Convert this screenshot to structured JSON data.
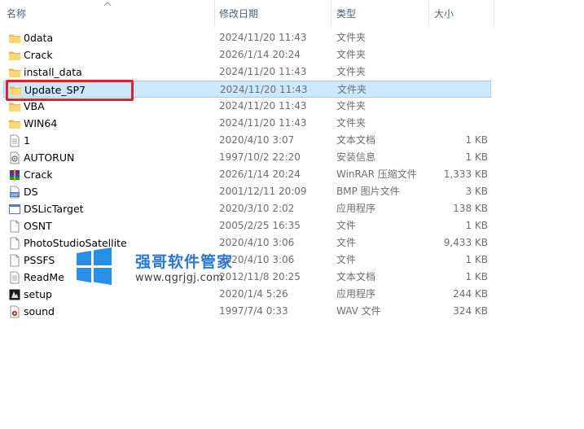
{
  "columns": {
    "name": "名称",
    "date": "修改日期",
    "type": "类型",
    "size": "大小"
  },
  "files": [
    {
      "name": "0data",
      "date": "2024/11/20 11:43",
      "type": "文件夹",
      "size": "",
      "icon": "folder-icon"
    },
    {
      "name": "Crack",
      "date": "2026/1/14 20:24",
      "type": "文件夹",
      "size": "",
      "icon": "folder-icon"
    },
    {
      "name": "install_data",
      "date": "2024/11/20 11:43",
      "type": "文件夹",
      "size": "",
      "icon": "folder-icon"
    },
    {
      "name": "Update_SP7",
      "date": "2024/11/20 11:43",
      "type": "文件夹",
      "size": "",
      "icon": "folder-icon",
      "selected": true
    },
    {
      "name": "VBA",
      "date": "2024/11/20 11:43",
      "type": "文件夹",
      "size": "",
      "icon": "folder-icon"
    },
    {
      "name": "WIN64",
      "date": "2024/11/20 11:43",
      "type": "文件夹",
      "size": "",
      "icon": "folder-icon"
    },
    {
      "name": "1",
      "date": "2020/4/10 3:07",
      "type": "文本文档",
      "size": "1 KB",
      "icon": "text-document-icon"
    },
    {
      "name": "AUTORUN",
      "date": "1997/10/2 22:20",
      "type": "安装信息",
      "size": "1 KB",
      "icon": "setup-info-icon"
    },
    {
      "name": "Crack",
      "date": "2026/1/14 20:24",
      "type": "WinRAR 压缩文件",
      "size": "1,333 KB",
      "icon": "winrar-archive-icon"
    },
    {
      "name": "DS",
      "date": "2001/12/11 20:09",
      "type": "BMP 图片文件",
      "size": "3 KB",
      "icon": "bmp-image-icon"
    },
    {
      "name": "DSLicTarget",
      "date": "2020/3/10 2:02",
      "type": "应用程序",
      "size": "138 KB",
      "icon": "application-icon"
    },
    {
      "name": "OSNT",
      "date": "2005/2/25 16:35",
      "type": "文件",
      "size": "1 KB",
      "icon": "blank-file-icon"
    },
    {
      "name": "PhotoStudioSatellite",
      "date": "2020/4/10 3:06",
      "type": "文件",
      "size": "9,433 KB",
      "icon": "blank-file-icon"
    },
    {
      "name": "PSSFS",
      "date": "2020/4/10 3:06",
      "type": "文件",
      "size": "1 KB",
      "icon": "blank-file-icon"
    },
    {
      "name": "ReadMe",
      "date": "2012/11/8 20:25",
      "type": "文本文档",
      "size": "1 KB",
      "icon": "text-document-icon"
    },
    {
      "name": "setup",
      "date": "2020/1/4 5:26",
      "type": "应用程序",
      "size": "244 KB",
      "icon": "setup-app-icon"
    },
    {
      "name": "sound",
      "date": "1997/7/4 0:33",
      "type": "WAV 文件",
      "size": "324 KB",
      "icon": "wav-audio-icon"
    }
  ],
  "watermark": {
    "title": "强哥软件管家",
    "url": "www.qgrjgj.com"
  },
  "colors": {
    "selection_bg": "#cce8ff",
    "selection_border": "#99d1ff",
    "highlight_box": "#e0202a",
    "folder": "#f8d775",
    "watermark_blue": "#1f6fd6"
  }
}
